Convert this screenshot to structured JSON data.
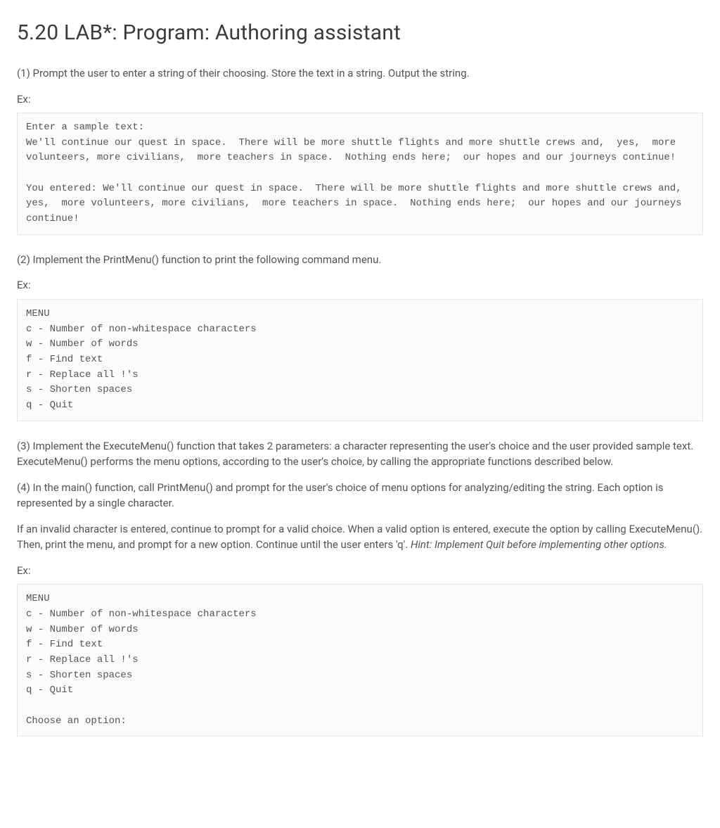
{
  "title": "5.20 LAB*: Program: Authoring assistant",
  "step1": {
    "text": "(1) Prompt the user to enter a string of their choosing. Store the text in a string. Output the string.",
    "ex_label": "Ex:",
    "code": "Enter a sample text:\nWe'll continue our quest in space.  There will be more shuttle flights and more shuttle crews and,  yes,  more volunteers, more civilians,  more teachers in space.  Nothing ends here;  our hopes and our journeys continue!\n\nYou entered: We'll continue our quest in space.  There will be more shuttle flights and more shuttle crews and,  yes,  more volunteers, more civilians,  more teachers in space.  Nothing ends here;  our hopes and our journeys continue!"
  },
  "step2": {
    "text": "(2) Implement the PrintMenu() function to print the following command menu.",
    "ex_label": "Ex:",
    "code": "MENU\nc - Number of non-whitespace characters\nw - Number of words\nf - Find text\nr - Replace all !'s\ns - Shorten spaces\nq - Quit"
  },
  "step3": {
    "text": "(3) Implement the ExecuteMenu() function that takes 2 parameters: a character representing the user's choice and the user provided sample text. ExecuteMenu() performs the menu options, according to the user's choice, by calling the appropriate functions described below."
  },
  "step4": {
    "p1": "(4) In the main() function, call PrintMenu() and prompt for the user's choice of menu options for analyzing/editing the string. Each option is represented by a single character.",
    "p2_a": "If an invalid character is entered, continue to prompt for a valid choice. When a valid option is entered, execute the option by calling ExecuteMenu(). Then, print the menu, and prompt for a new option. Continue until the user enters 'q'. ",
    "p2_hint": "Hint: Implement Quit before implementing other options.",
    "ex_label": "Ex:",
    "code": "MENU\nc - Number of non-whitespace characters\nw - Number of words\nf - Find text\nr - Replace all !'s\ns - Shorten spaces\nq - Quit\n\nChoose an option:"
  }
}
